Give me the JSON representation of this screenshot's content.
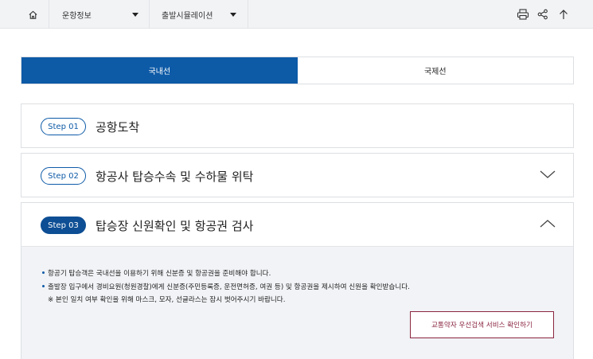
{
  "topbar": {
    "breadcrumb": [
      {
        "label": "운항정보"
      },
      {
        "label": "출발시뮬레이션"
      }
    ],
    "icons": [
      "home-icon",
      "print-icon",
      "share-icon",
      "arrow-up-icon"
    ]
  },
  "tabs": [
    {
      "label": "국내선",
      "active": true
    },
    {
      "label": "국제선",
      "active": false
    }
  ],
  "steps": [
    {
      "badge": "Step 01",
      "title": "공항도착",
      "state": "plain"
    },
    {
      "badge": "Step 02",
      "title": "항공사 탑승수속 및 수하물 위탁",
      "state": "collapsed"
    },
    {
      "badge": "Step 03",
      "title": "탑승장 신원확인 및 항공권 검사",
      "state": "expanded"
    }
  ],
  "step3_content": {
    "lines": [
      "항공기 탑승객은 국내선을 이용하기 위해 신분증 및 항공권을 준비해야 합니다.",
      "출발장 입구에서 경비요원(청원경찰)에게 신분증(주민등록증, 운전면허증, 여권 등) 및 항공권을 제시하여 신원을 확인받습니다.",
      "※ 본인 일치 여부 확인을 위해 마스크, 모자, 선글라스는 잠시 벗어주시기 바랍니다."
    ],
    "button_label": "교통약자 우선검색 서비스 확인하기"
  },
  "colors": {
    "primary": "#0d5aa7",
    "accent_button": "#8a2540",
    "panel_bg": "#f1f3f6",
    "topbar_bg": "#f2f3f5"
  }
}
